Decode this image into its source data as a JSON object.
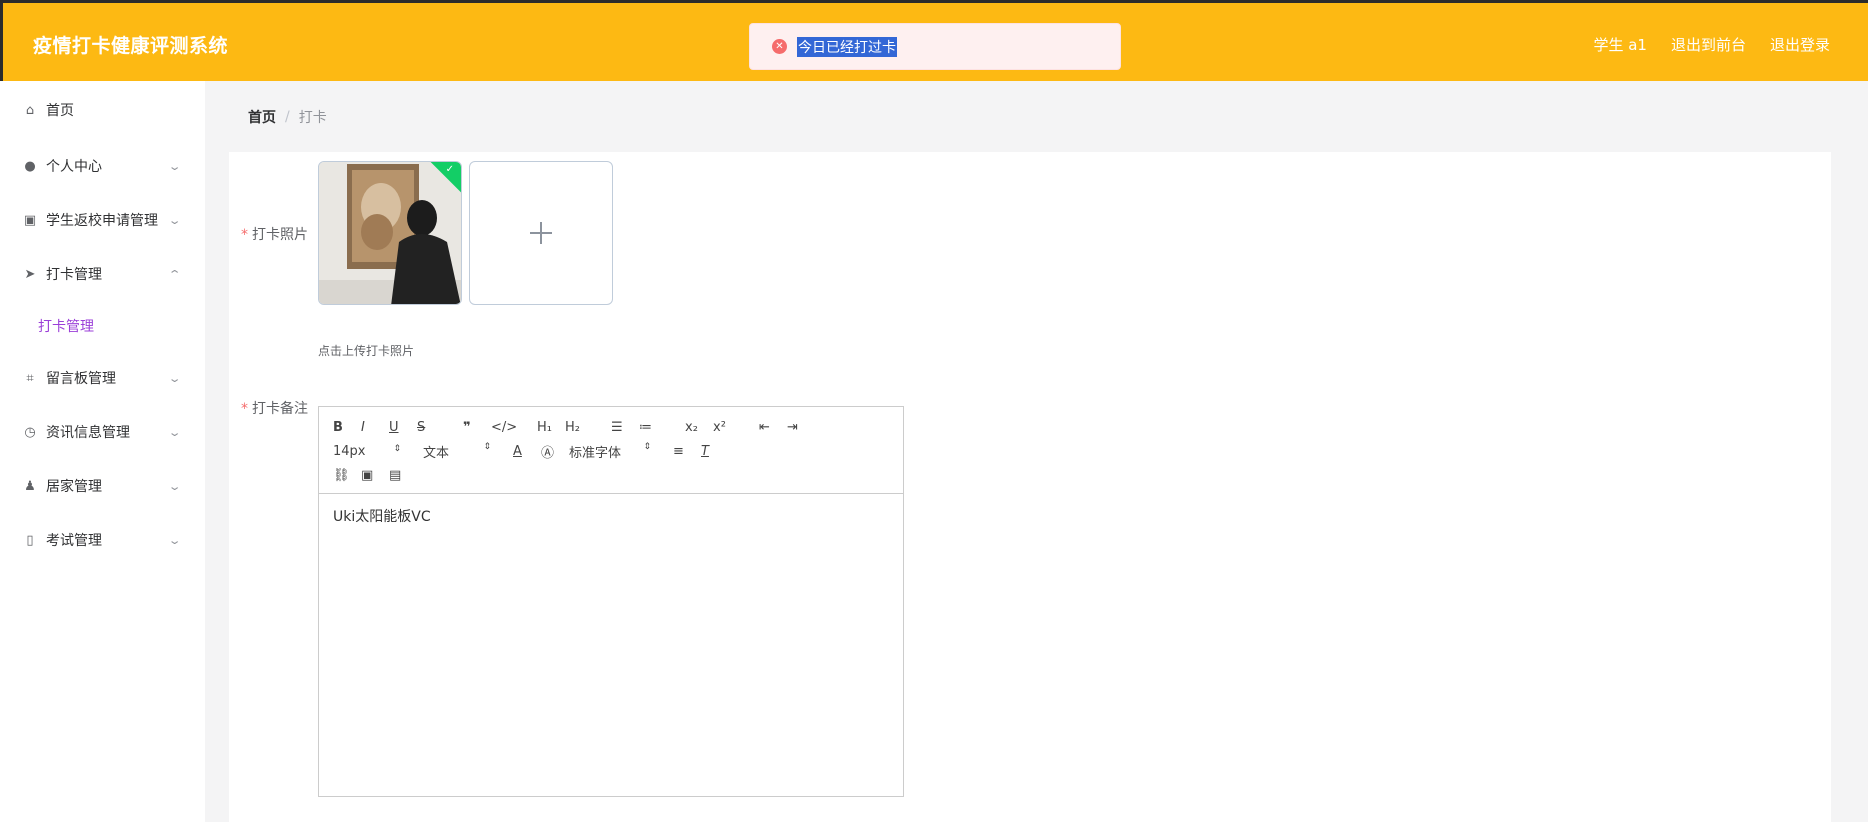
{
  "header": {
    "title": "疫情打卡健康评测系统",
    "user_label": "学生 a1",
    "front_label": "退出到前台",
    "logout_label": "退出登录"
  },
  "toast": {
    "icon": "error-circle-icon",
    "message": "今日已经打过卡"
  },
  "sidebar": {
    "items": [
      {
        "label": "首页",
        "icon": "home-icon",
        "has_arrow": false
      },
      {
        "label": "个人中心",
        "icon": "user-icon",
        "has_arrow": true,
        "arrow": "down"
      },
      {
        "label": "学生返校申请管理",
        "icon": "clipboard-icon",
        "has_arrow": true,
        "arrow": "down"
      },
      {
        "label": "打卡管理",
        "icon": "send-icon",
        "has_arrow": true,
        "arrow": "up"
      },
      {
        "label": "留言板管理",
        "icon": "crop-icon",
        "has_arrow": true,
        "arrow": "down"
      },
      {
        "label": "资讯信息管理",
        "icon": "compass-icon",
        "has_arrow": true,
        "arrow": "down"
      },
      {
        "label": "居家管理",
        "icon": "stamp-icon",
        "has_arrow": true,
        "arrow": "down"
      },
      {
        "label": "考试管理",
        "icon": "bulb-icon",
        "has_arrow": true,
        "arrow": "down"
      }
    ],
    "submenu_label": "打卡管理"
  },
  "breadcrumb": {
    "home": "首页",
    "separator": "/",
    "current": "打卡"
  },
  "form": {
    "photo_label": "打卡照片",
    "photo_tip": "点击上传打卡照片",
    "remark_label": "打卡备注",
    "required_mark": "*"
  },
  "editor": {
    "size_value": "14px",
    "header_value": "文本",
    "font_value": "标准字体",
    "content": "Uki太阳能板VC"
  },
  "colors": {
    "header_bg": "#fdb913",
    "submenu_active": "#9b3fd8",
    "error": "#f56c6c",
    "success": "#13ce66"
  }
}
